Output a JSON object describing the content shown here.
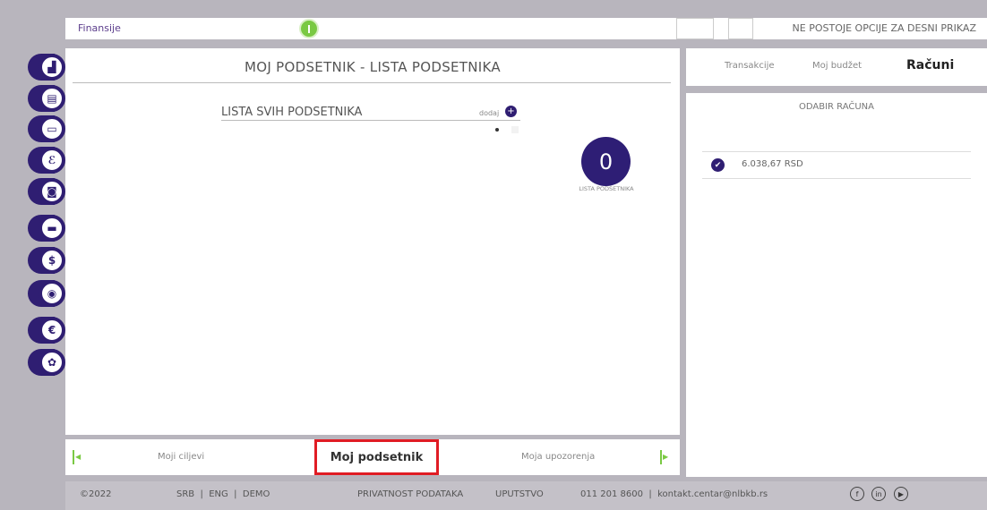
{
  "topbar": {
    "section": "Finansije",
    "right_note": "NE POSTOJE OPCIJE ZA DESNI PRIKAZ"
  },
  "sidebar": {
    "items": [
      {
        "icon": "chart-icon",
        "glyph": "▟"
      },
      {
        "icon": "clipboard-icon",
        "glyph": "▤"
      },
      {
        "icon": "card-icon",
        "glyph": "▭"
      },
      {
        "icon": "leaf-icon",
        "glyph": "ℰ"
      },
      {
        "icon": "money-icon",
        "glyph": "◙"
      },
      {
        "icon": "minus-icon",
        "glyph": "▬"
      },
      {
        "icon": "dollar-icon",
        "glyph": "$"
      },
      {
        "icon": "location-icon",
        "glyph": "◉"
      },
      {
        "icon": "euro-icon",
        "glyph": "€"
      },
      {
        "icon": "settings-icon",
        "glyph": "✿"
      }
    ]
  },
  "main": {
    "title": "MOJ PODSETNIK - LISTA PODSETNIKA",
    "list_title": "LISTA SVIH PODSETNIKA",
    "add_label": "dodaj",
    "add_glyph": "+",
    "count": "0",
    "count_label": "LISTA PODSETNIKA"
  },
  "bottomnav": {
    "left": "Moji ciljevi",
    "active": "Moj podsetnik",
    "right": "Moja upozorenja"
  },
  "right_panel": {
    "tabs": [
      "Transakcije",
      "Moj budžet",
      "Računi"
    ],
    "heading": "ODABIR RAČUNA",
    "account": "6.038,67 RSD"
  },
  "footer": {
    "year": "©2022",
    "langs": "SRB  |  ENG  |  DEMO",
    "privacy": "PRIVATNOST PODATAKA",
    "guide": "UPUTSTVO",
    "contact": "011 201 8600  |  kontakt.centar@nlbkb.rs",
    "social": [
      "f",
      "in",
      "▶"
    ]
  },
  "colors": {
    "brand": "#2f1e72",
    "accent_green": "#7ac943",
    "highlight_red": "#e01c24"
  }
}
